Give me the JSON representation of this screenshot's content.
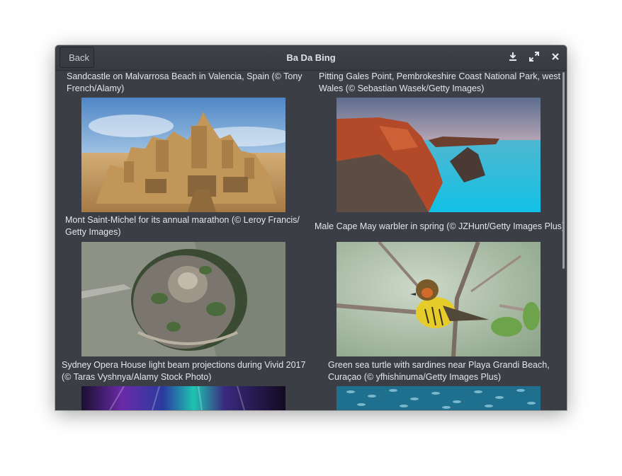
{
  "window": {
    "title": "Ba Da Bing",
    "back_label": "Back"
  },
  "toolbar": {
    "icons": [
      "download-icon",
      "fullscreen-icon",
      "close-icon"
    ]
  },
  "gallery": {
    "items": [
      {
        "caption": "Sandcastle on Malvarrosa Beach in Valencia, Spain (© Tony French/Alamy)",
        "image": "sandcastle-photo"
      },
      {
        "caption": "Pitting Gales Point, Pembrokeshire Coast National Park, west Wales (© Sebastian Wasek/Getty Images)",
        "image": "coast-cliffs-photo"
      },
      {
        "caption": "Mont Saint-Michel for its annual marathon (© Leroy Francis/ Getty Images)",
        "image": "mont-saint-michel-photo"
      },
      {
        "caption": "Male Cape May warbler in spring (© JZHunt/Getty Images Plus)",
        "image": "warbler-photo"
      },
      {
        "caption": "Sydney Opera House light beam projections during Vivid 2017 (© Taras Vyshnya/Alamy Stock Photo)",
        "image": "opera-house-photo"
      },
      {
        "caption": "Green sea turtle with sardines near Playa Grandi Beach, Curaçao (© yfhishinuma/Getty Images Plus)",
        "image": "sea-turtle-photo"
      }
    ]
  },
  "colors": {
    "window_bg": "#3b3e45",
    "titlebar_bg": "#3a3d43",
    "caption_text": "#e4e6ea"
  }
}
